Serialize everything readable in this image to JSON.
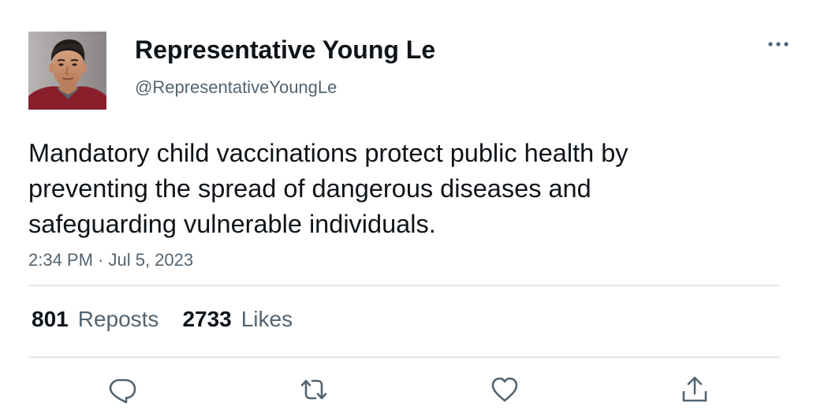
{
  "author": {
    "display_name": "Representative Young Le",
    "handle": "@RepresentativeYoungLe",
    "avatar_icon": "profile-photo"
  },
  "tweet": {
    "text": "Mandatory child vaccinations protect public health by\npreventing the spread of dangerous diseases and\nsafeguarding vulnerable individuals.",
    "timestamp": "2:34 PM · Jul 5, 2023"
  },
  "stats": {
    "reposts_count": "801",
    "reposts_label": "Reposts",
    "likes_count": "2733",
    "likes_label": "Likes"
  },
  "actions": {
    "more_icon": "more-horizontal-icon",
    "reply_icon": "reply-icon",
    "repost_icon": "repost-icon",
    "like_icon": "heart-icon",
    "share_icon": "share-icon"
  },
  "colors": {
    "text_primary": "#0f1419",
    "text_secondary": "#536471",
    "divider": "#e1e6ea",
    "icon": "#536471"
  }
}
